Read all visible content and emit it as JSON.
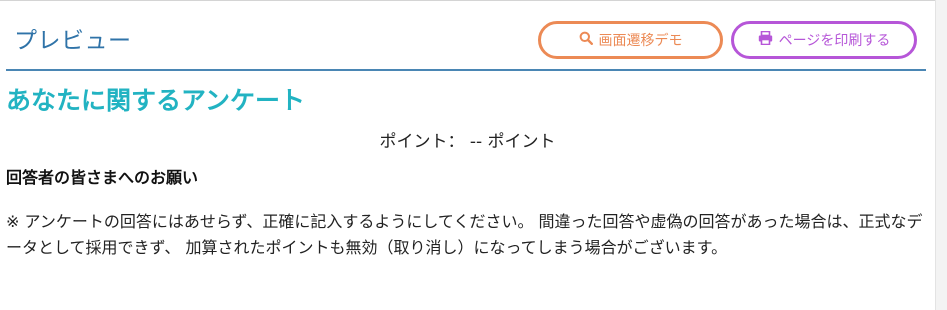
{
  "header": {
    "title": "プレビュー",
    "buttons": {
      "demo_label": "画面遷移デモ",
      "print_label": "ページを印刷する"
    }
  },
  "survey": {
    "title": "あなたに関するアンケート",
    "points_label": "ポイント：",
    "points_value": "-- ポイント",
    "request_heading": "回答者の皆さまへのお願い",
    "notice": "※ アンケートの回答にはあせらず、正確に記入するようにしてください。 間違った回答や虚偽の回答があった場合は、正式なデータとして採用できず、 加算されたポイントも無効（取り消し）になってしまう場合がございます。"
  },
  "colors": {
    "title_blue": "#2f73a8",
    "survey_title_teal": "#22b3c2",
    "demo_orange": "#ec8a55",
    "print_purple": "#b656d8",
    "divider_blue": "#4a86b4"
  },
  "icons": {
    "demo": "search-icon",
    "print": "print-icon"
  }
}
